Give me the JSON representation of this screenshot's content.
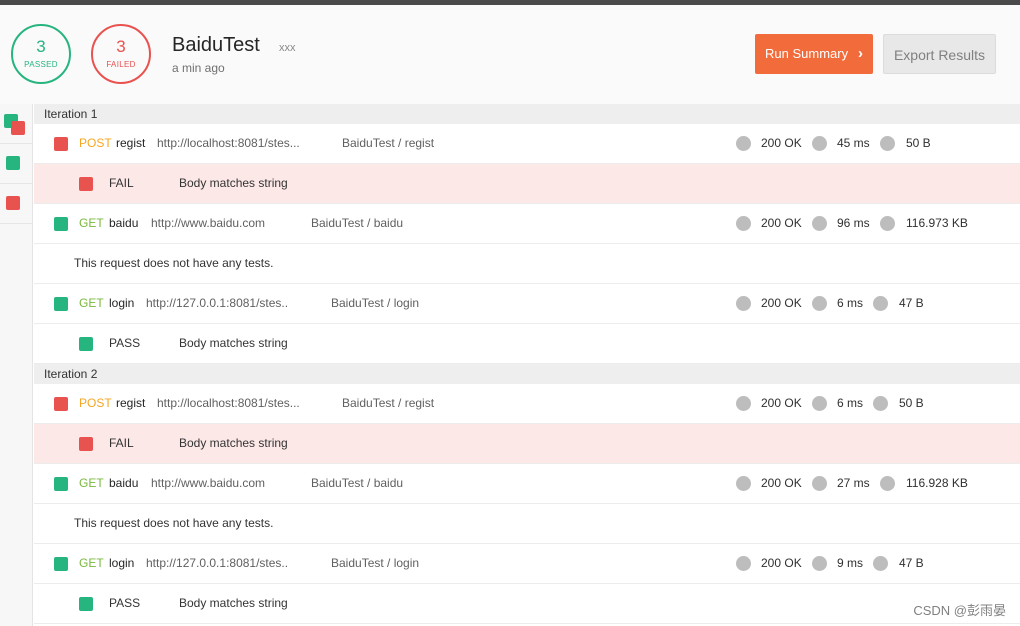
{
  "header": {
    "passed_count": "3",
    "passed_label": "PASSED",
    "failed_count": "3",
    "failed_label": "FAILED",
    "collection_name": "BaiduTest",
    "environment": "xxx",
    "time_ago": "a min ago",
    "run_summary_label": "Run Summary",
    "export_label": "Export Results"
  },
  "colors": {
    "pass": "#26b47f",
    "fail": "#e8524f",
    "post": "#f5a623",
    "get": "#7ab83c",
    "accent": "#f26b3a"
  },
  "iterations": [
    {
      "label": "Iteration 1",
      "requests": [
        {
          "status": "fail",
          "method": "POST",
          "name": "regist",
          "url": "http://localhost:8081/stes...",
          "path": "BaiduTest / regist",
          "code": "200 OK",
          "time": "45 ms",
          "size": "50 B",
          "tests": [
            {
              "result": "FAIL",
              "name": "Body matches string"
            }
          ]
        },
        {
          "status": "pass",
          "method": "GET",
          "name": "baidu",
          "url": "http://www.baidu.com",
          "path": "BaiduTest / baidu",
          "code": "200 OK",
          "time": "96 ms",
          "size": "116.973 KB",
          "note": "This request does not have any tests."
        },
        {
          "status": "pass",
          "method": "GET",
          "name": "login",
          "url": "http://127.0.0.1:8081/stes..",
          "path": "BaiduTest / login",
          "code": "200 OK",
          "time": "6 ms",
          "size": "47 B",
          "tests": [
            {
              "result": "PASS",
              "name": "Body matches string"
            }
          ]
        }
      ]
    },
    {
      "label": "Iteration 2",
      "requests": [
        {
          "status": "fail",
          "method": "POST",
          "name": "regist",
          "url": "http://localhost:8081/stes...",
          "path": "BaiduTest / regist",
          "code": "200 OK",
          "time": "6 ms",
          "size": "50 B",
          "tests": [
            {
              "result": "FAIL",
              "name": "Body matches string"
            }
          ]
        },
        {
          "status": "pass",
          "method": "GET",
          "name": "baidu",
          "url": "http://www.baidu.com",
          "path": "BaiduTest / baidu",
          "code": "200 OK",
          "time": "27 ms",
          "size": "116.928 KB",
          "note": "This request does not have any tests."
        },
        {
          "status": "pass",
          "method": "GET",
          "name": "login",
          "url": "http://127.0.0.1:8081/stes..",
          "path": "BaiduTest / login",
          "code": "200 OK",
          "time": "9 ms",
          "size": "47 B",
          "tests": [
            {
              "result": "PASS",
              "name": "Body matches string"
            }
          ]
        }
      ]
    }
  ],
  "watermark": "CSDN @彭雨晏"
}
